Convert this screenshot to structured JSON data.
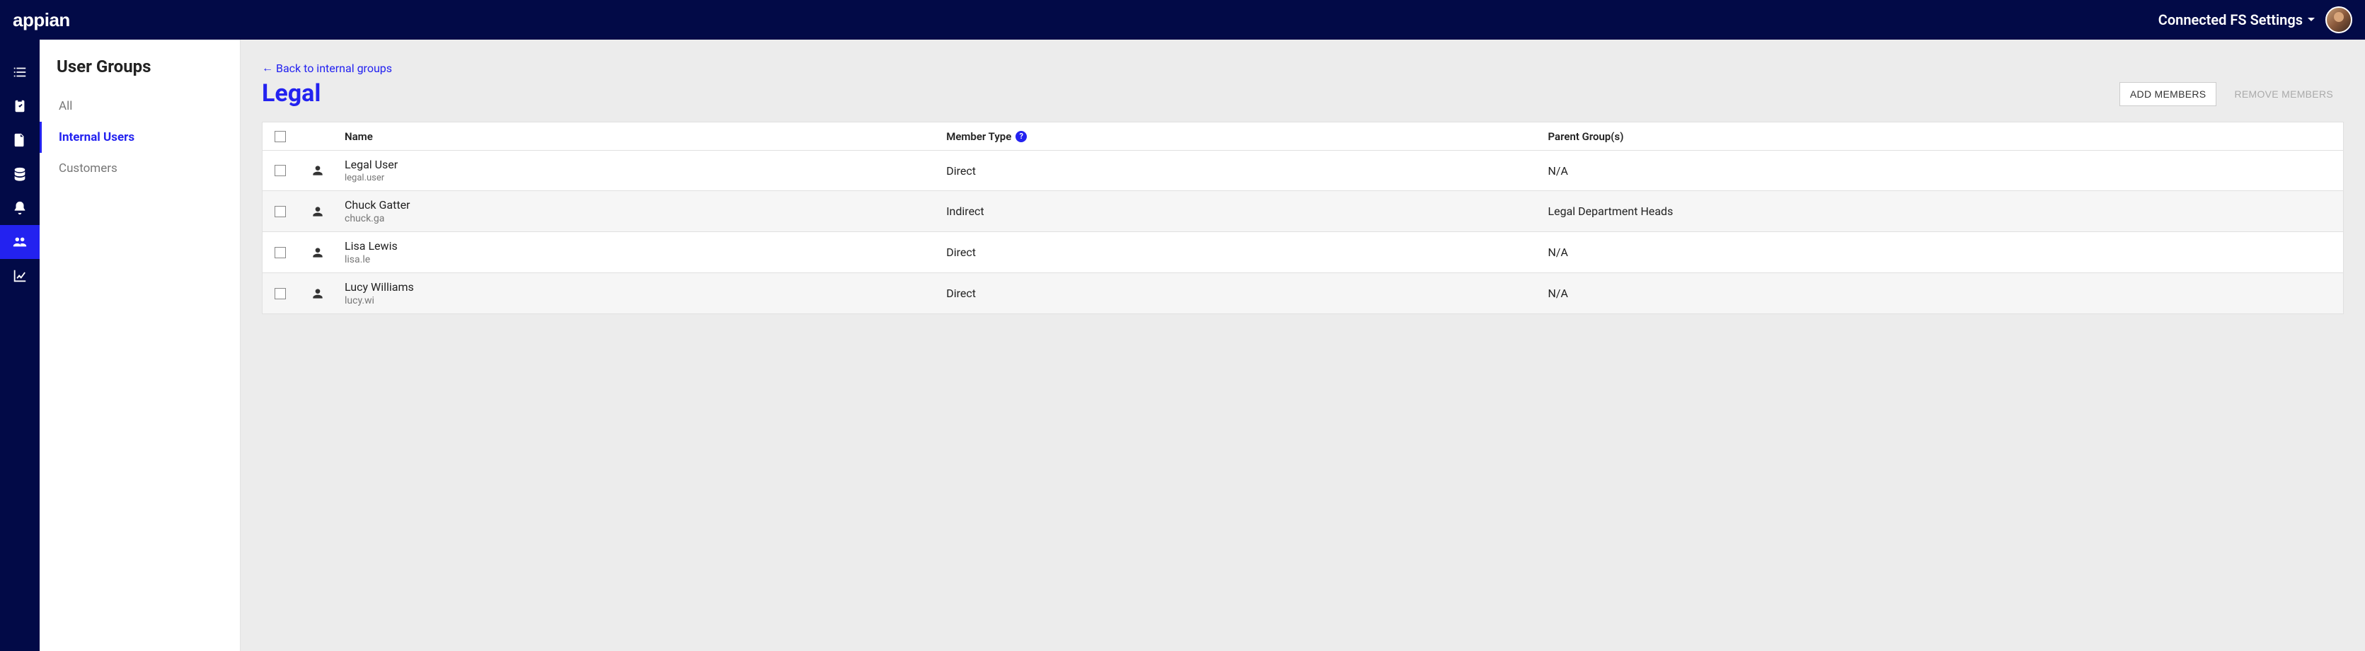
{
  "topbar": {
    "logo_text": "appian",
    "settings_label": "Connected FS Settings"
  },
  "rail": {
    "items": [
      {
        "name": "tasks-icon",
        "active": false
      },
      {
        "name": "clipboard-icon",
        "active": false
      },
      {
        "name": "document-icon",
        "active": false
      },
      {
        "name": "database-icon",
        "active": false
      },
      {
        "name": "bell-icon",
        "active": false
      },
      {
        "name": "users-icon",
        "active": true
      },
      {
        "name": "chart-icon",
        "active": false
      }
    ]
  },
  "sidebar": {
    "title": "User Groups",
    "items": [
      {
        "label": "All",
        "active": false
      },
      {
        "label": "Internal Users",
        "active": true
      },
      {
        "label": "Customers",
        "active": false
      }
    ]
  },
  "content": {
    "back_label": "Back to internal groups",
    "title": "Legal",
    "actions": {
      "add_members": "ADD MEMBERS",
      "remove_members": "REMOVE MEMBERS"
    },
    "columns": {
      "name": "Name",
      "member_type": "Member Type",
      "parent_groups": "Parent Group(s)"
    },
    "rows": [
      {
        "name": "Legal User",
        "sub": "legal.user",
        "sub_small": true,
        "member_type": "Direct",
        "parent": "N/A"
      },
      {
        "name": "Chuck Gatter",
        "sub": "chuck.ga",
        "sub_small": false,
        "member_type": "Indirect",
        "parent": "Legal Department Heads"
      },
      {
        "name": "Lisa Lewis",
        "sub": "lisa.le",
        "sub_small": false,
        "member_type": "Direct",
        "parent": "N/A"
      },
      {
        "name": "Lucy Williams",
        "sub": "lucy.wi",
        "sub_small": false,
        "member_type": "Direct",
        "parent": "N/A"
      }
    ]
  }
}
